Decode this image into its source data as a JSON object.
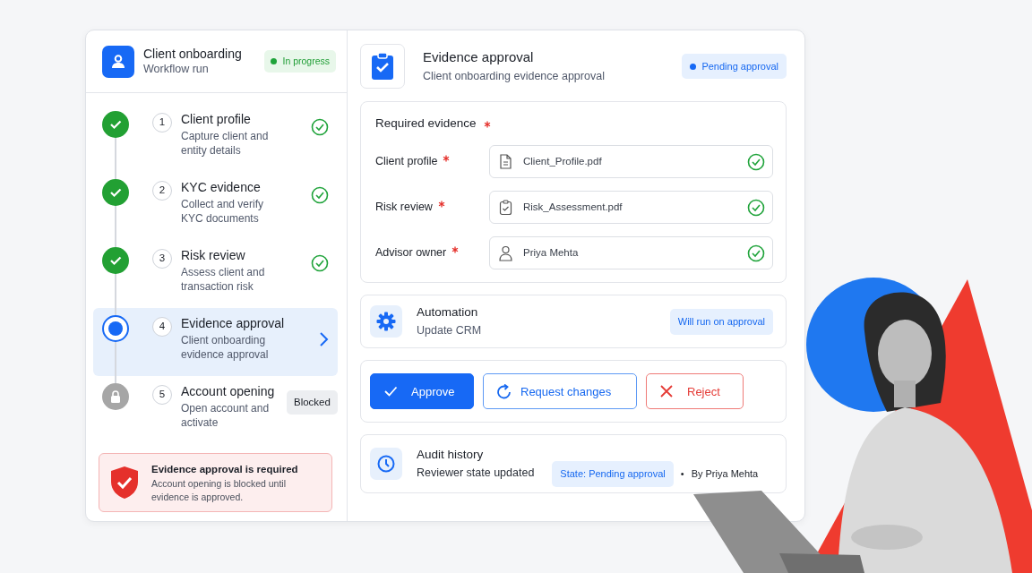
{
  "header": {
    "title": "Client onboarding",
    "subtitle": "Workflow run",
    "status": "In progress"
  },
  "steps": [
    {
      "number": "1",
      "title": "Client profile",
      "description": "Capture client and entity details",
      "kind": "done",
      "selected": false
    },
    {
      "number": "2",
      "title": "KYC evidence",
      "description": "Collect and verify KYC documents",
      "kind": "done",
      "selected": false
    },
    {
      "number": "3",
      "title": "Risk review",
      "description": "Assess client and transaction risk",
      "kind": "done",
      "selected": false
    },
    {
      "number": "4",
      "title": "Evidence approval",
      "description": "Client onboarding evidence approval",
      "kind": "current",
      "selected": true
    },
    {
      "number": "5",
      "title": "Account opening",
      "description": "Open account and activate",
      "kind": "blocked",
      "selected": false,
      "badge": "Blocked"
    }
  ],
  "alert": {
    "title": "Evidence approval is required",
    "message": "Account opening is blocked until evidence is approved."
  },
  "detail": {
    "title": "Evidence approval",
    "subtitle": "Client onboarding evidence approval",
    "status": "Pending approval"
  },
  "evidence": {
    "title": "Required evidence",
    "required": true,
    "fields": [
      {
        "label": "Client profile",
        "required": true,
        "kind": "file",
        "value": "Client_Profile.pdf",
        "verified": true
      },
      {
        "label": "Risk review",
        "required": true,
        "kind": "assessment",
        "value": "Risk_Assessment.pdf",
        "verified": true
      },
      {
        "label": "Advisor owner",
        "required": true,
        "kind": "person",
        "value": "Priya Mehta",
        "verified": true
      }
    ]
  },
  "automation": {
    "title": "Automation",
    "subtitle": "Update CRM",
    "badge": "Will run on approval"
  },
  "actions": [
    {
      "label": "Approve",
      "kind": "approve"
    },
    {
      "label": "Request changes",
      "kind": "request"
    },
    {
      "label": "Reject",
      "kind": "reject"
    }
  ],
  "audit": {
    "title": "Audit history",
    "event": "Reviewer state updated",
    "state": "State: Pending approval",
    "separator": "•",
    "author": "By Priya Mehta"
  }
}
